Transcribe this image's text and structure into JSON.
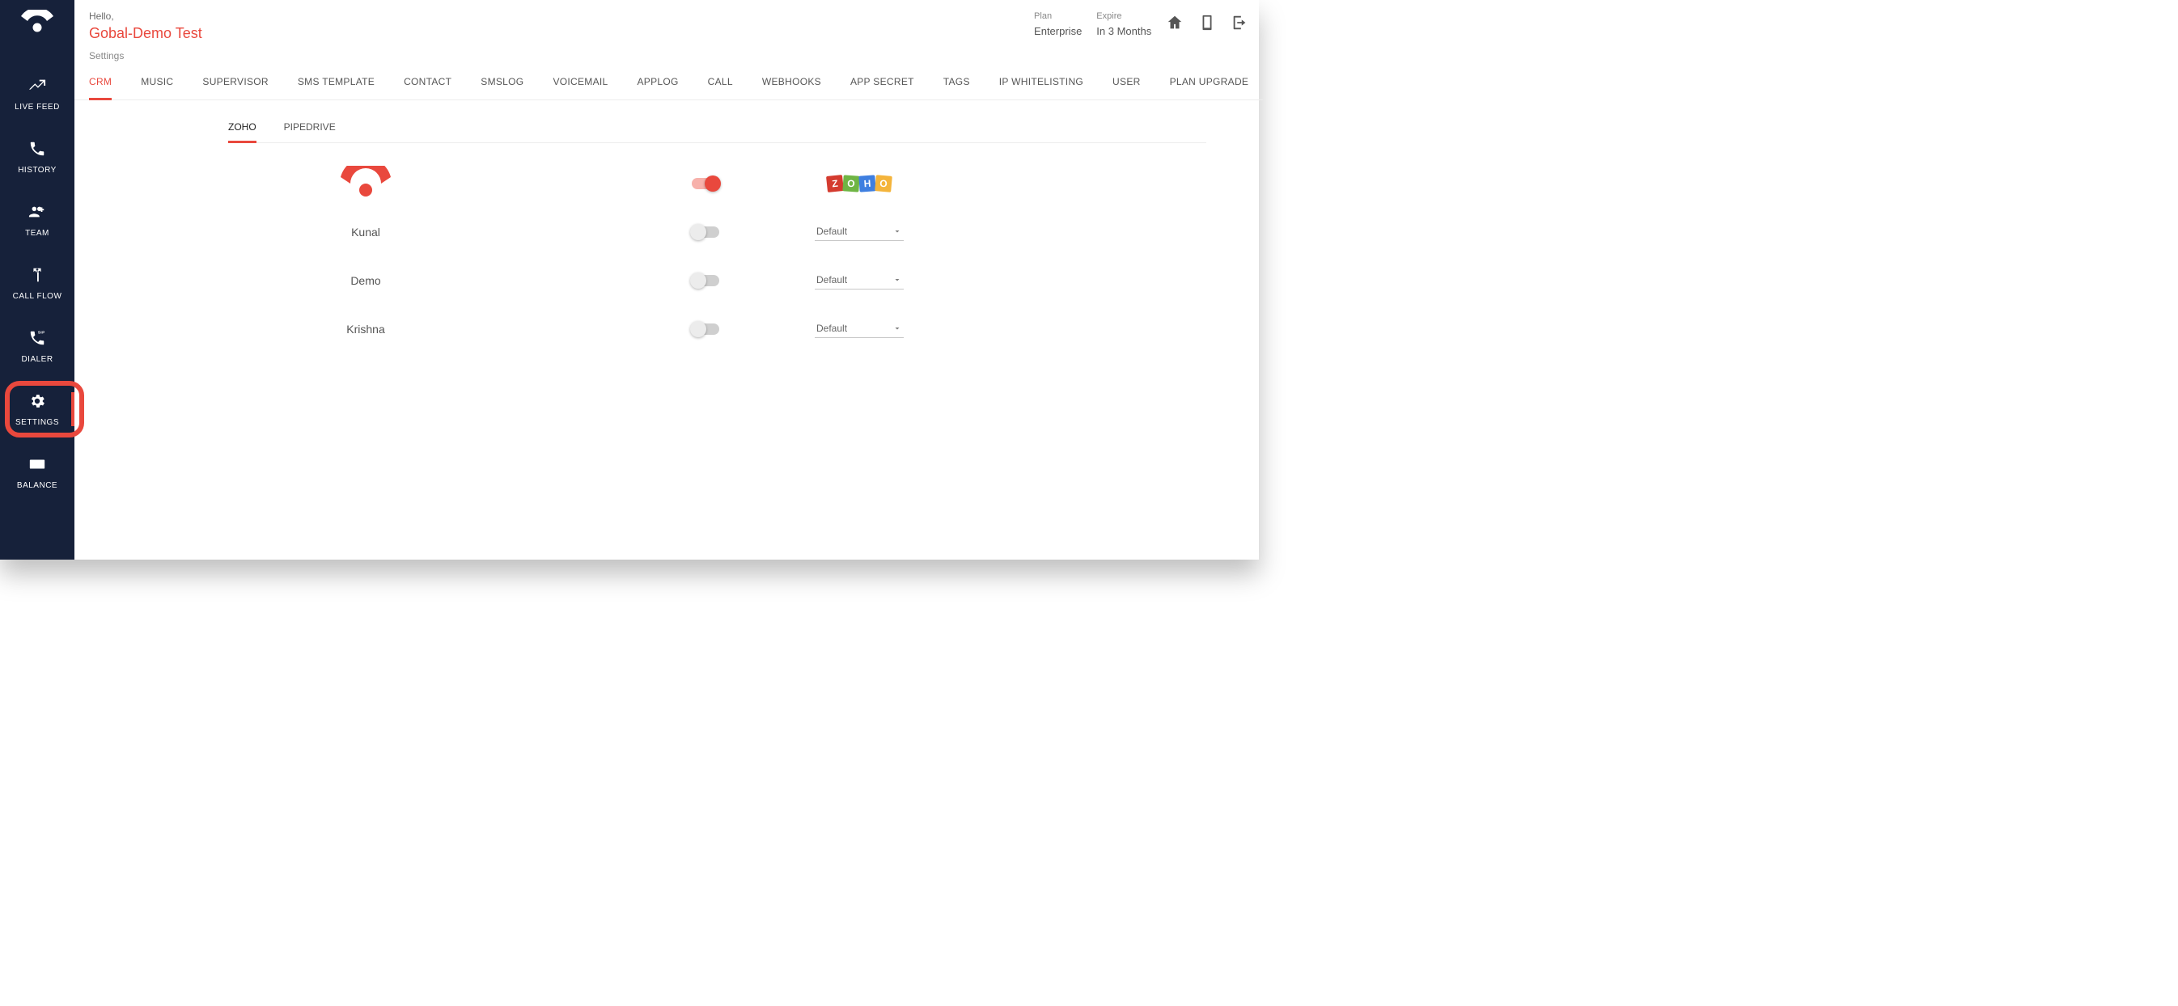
{
  "header": {
    "hello": "Hello,",
    "tenant": "Gobal-Demo Test",
    "plan_label": "Plan",
    "plan_value": "Enterprise",
    "expire_label": "Expire",
    "expire_value": "In 3 Months"
  },
  "breadcrumb": "Settings",
  "sidebar": {
    "items": [
      {
        "label": "LIVE FEED",
        "icon": "trend"
      },
      {
        "label": "HISTORY",
        "icon": "phone"
      },
      {
        "label": "TEAM",
        "icon": "group-add"
      },
      {
        "label": "CALL FLOW",
        "icon": "split"
      },
      {
        "label": "DIALER",
        "icon": "phone-sip"
      },
      {
        "label": "SETTINGS",
        "icon": "gear",
        "active": true
      },
      {
        "label": "BALANCE",
        "icon": "card"
      }
    ]
  },
  "settings_tabs": [
    "CRM",
    "MUSIC",
    "SUPERVISOR",
    "SMS TEMPLATE",
    "CONTACT",
    "SMSLOG",
    "VOICEMAIL",
    "APPLOG",
    "CALL",
    "WEBHOOKS",
    "APP SECRET",
    "TAGS",
    "IP WHITELISTING",
    "USER",
    "PLAN UPGRADE"
  ],
  "settings_tab_active": "CRM",
  "crm_subtabs": [
    "ZOHO",
    "PIPEDRIVE"
  ],
  "crm_subtab_active": "ZOHO",
  "crm": {
    "master_toggle": true,
    "users": [
      {
        "name": "Kunal",
        "enabled": false,
        "mapping": "Default"
      },
      {
        "name": "Demo",
        "enabled": false,
        "mapping": "Default"
      },
      {
        "name": "Krishna",
        "enabled": false,
        "mapping": "Default"
      }
    ]
  },
  "zoho_letters": [
    "Z",
    "O",
    "H",
    "O"
  ],
  "colors": {
    "accent": "#e9483d",
    "sidebar_bg": "#16213a"
  }
}
